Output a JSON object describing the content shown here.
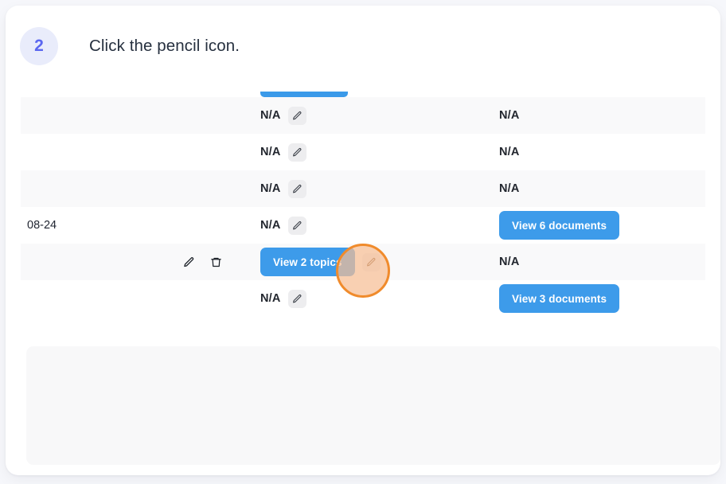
{
  "colors": {
    "page_background": "#f6f7fb",
    "card_background": "#ffffff",
    "badge_background": "#e9ecfb",
    "badge_text": "#5b67f0",
    "title_text": "#26303f",
    "row_striped": "#f9f9fa",
    "primary_button": "#3d9bea",
    "pencil_chip_background": "#ededef",
    "highlight_ring": "#f08b2c",
    "highlight_fill": "#f7be94",
    "empty_panel": "#f8f8f9"
  },
  "header": {
    "step_number": "2",
    "instruction": "Click the pencil icon."
  },
  "table": {
    "clipped_button_above": true,
    "rows": [
      {
        "striped": true,
        "date": "",
        "row_actions": [],
        "mid_type": "na",
        "mid_label": "N/A",
        "mid_has_pencil": true,
        "right_type": "na",
        "right_label": "N/A"
      },
      {
        "striped": false,
        "date": "",
        "row_actions": [],
        "mid_type": "na",
        "mid_label": "N/A",
        "mid_has_pencil": true,
        "right_type": "na",
        "right_label": "N/A"
      },
      {
        "striped": true,
        "date": "",
        "row_actions": [],
        "mid_type": "na",
        "mid_label": "N/A",
        "mid_has_pencil": true,
        "right_type": "na",
        "right_label": "N/A"
      },
      {
        "striped": false,
        "date": "08-24",
        "row_actions": [],
        "mid_type": "na",
        "mid_label": "N/A",
        "mid_has_pencil": true,
        "right_type": "button",
        "right_label": "View 6 documents"
      },
      {
        "striped": true,
        "date": "",
        "row_actions": [
          "edit-icon",
          "delete-icon"
        ],
        "mid_type": "button",
        "mid_label": "View 2 topics",
        "mid_has_pencil": true,
        "right_type": "na",
        "right_label": "N/A"
      },
      {
        "striped": false,
        "date": "",
        "row_actions": [],
        "mid_type": "na",
        "mid_label": "N/A",
        "mid_has_pencil": true,
        "right_type": "button",
        "right_label": "View 3 documents"
      }
    ]
  },
  "highlight": {
    "target": "pencil-icon",
    "row_index": 4
  }
}
